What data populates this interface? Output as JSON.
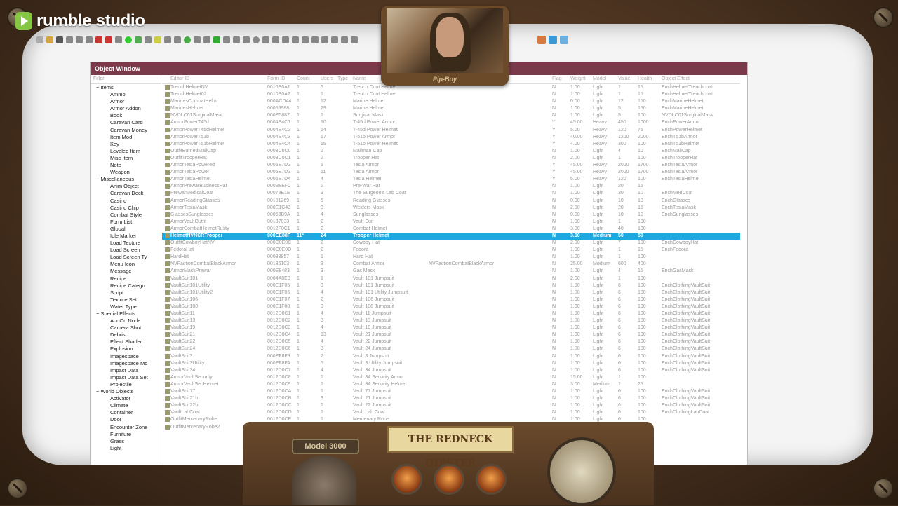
{
  "logo": {
    "brand": "rumble studio"
  },
  "webcam": {
    "label": "Pip-Boy"
  },
  "console": {
    "model_label": "Model 3000",
    "brand_label": "THE REDNECK HIPSTER"
  },
  "object_window": {
    "title": "Object Window",
    "filter_placeholder": "Filter",
    "tree": [
      "Items",
      "Ammo",
      "Armor",
      "Armor Addon",
      "Book",
      "Caravan Card",
      "Caravan Money",
      "Item Mod",
      "Key",
      "Leveled Item",
      "Misc Item",
      "Note",
      "Weapon",
      "Miscellaneous",
      "Anim Object",
      "Caravan Deck",
      "Casino",
      "Casino Chip",
      "Combat Style",
      "Form List",
      "Global",
      "Idle Marker",
      "Load Texture",
      "Load Screen",
      "Load Screen Ty",
      "Menu Icon",
      "Message",
      "Recipe",
      "Recipe Catego",
      "Script",
      "Texture Set",
      "Water Type",
      "Special Effects",
      "AddOn Node",
      "Camera Shot",
      "Debris",
      "Effect Shader",
      "Explosion",
      "Imagespace",
      "Imagespace Mo",
      "Impact Data",
      "Impact Data Set",
      "Projectile",
      "World Objects",
      "Activator",
      "Climate",
      "Container",
      "Door",
      "Encounter Zone",
      "Furniture",
      "Grass",
      "Light"
    ],
    "columns": [
      "Editor ID",
      "Form ID",
      "Count",
      "Users",
      "Type",
      "Name",
      "",
      "Flag",
      "Weight",
      "Model",
      "Value",
      "Health",
      "Object Effect"
    ],
    "rows": [
      [
        "TrenchHelmetNV",
        "0010E0A1",
        "1",
        "5",
        "",
        "Trench Coat Helmet",
        "",
        "N",
        "1.00",
        "Light",
        "1",
        "15",
        "EnchHelmetTrenchcoat"
      ],
      [
        "TrenchHelmet02",
        "0010E0A2",
        "1",
        "1",
        "",
        "Trench Coat Helmet",
        "",
        "N",
        "1.00",
        "Light",
        "1",
        "15",
        "EnchHelmetTrenchcoat"
      ],
      [
        "MarinesCombatHelm",
        "000ACD44",
        "1",
        "12",
        "",
        "Marine Helmet",
        "",
        "N",
        "0.00",
        "Light",
        "12",
        "150",
        "EnchMarineHelmet"
      ],
      [
        "MarinesHelmet",
        "00053988",
        "1",
        "29",
        "",
        "Marine Helmet",
        "",
        "N",
        "1.00",
        "Light",
        "5",
        "150",
        "EnchMarineHelmet"
      ],
      [
        "NVDLC01SurgicalMask",
        "000E5887",
        "1",
        "1",
        "",
        "Surgical Mask",
        "",
        "N",
        "1.00",
        "Light",
        "5",
        "100",
        "NVDLC01SurgicalMask"
      ],
      [
        "ArmorPowerT45d",
        "0004E4C1",
        "1",
        "10",
        "",
        "T-45d Power Armor",
        "",
        "Y",
        "45.00",
        "Heavy",
        "450",
        "1000",
        "EnchPowerArmor"
      ],
      [
        "ArmorPowerT45dHelmet",
        "0004E4C2",
        "1",
        "14",
        "",
        "T-45d Power Helmet",
        "",
        "Y",
        "5.00",
        "Heavy",
        "120",
        "75",
        "EnchPowerHelmet"
      ],
      [
        "ArmorPowerT51b",
        "0004E4C3",
        "1",
        "17",
        "",
        "T-51b Power Armor",
        "",
        "Y",
        "40.00",
        "Heavy",
        "1200",
        "2000",
        "EnchT51bArmor"
      ],
      [
        "ArmorPowerT51bHelmet",
        "0004E4C4",
        "1",
        "15",
        "",
        "T-51b Power Helmet",
        "",
        "Y",
        "4.00",
        "Heavy",
        "300",
        "100",
        "EnchT51bHelmet"
      ],
      [
        "OutfitBurnedMailCap",
        "0003C0C0",
        "1",
        "2",
        "",
        "Mailman Cap",
        "",
        "N",
        "1.00",
        "Light",
        "4",
        "10",
        "EnchMailCap"
      ],
      [
        "OutfitTrooperHat",
        "0003C0C1",
        "1",
        "2",
        "",
        "Trooper Hat",
        "",
        "N",
        "2.00",
        "Light",
        "1",
        "100",
        "EnchTrooperHat"
      ],
      [
        "ArmorTeslaPowered",
        "0006E7D2",
        "1",
        "5",
        "",
        "Tesla Armor",
        "",
        "Y",
        "45.00",
        "Heavy",
        "2000",
        "1700",
        "EnchTeslaArmor"
      ],
      [
        "ArmorTeslaPower",
        "0006E7D3",
        "1",
        "11",
        "",
        "Tesla Armor",
        "",
        "Y",
        "45.00",
        "Heavy",
        "2000",
        "1700",
        "EnchTeslaArmor"
      ],
      [
        "ArmorTeslaHelmet",
        "0006E7D4",
        "1",
        "4",
        "",
        "Tesla Helmet",
        "",
        "Y",
        "5.00",
        "Heavy",
        "120",
        "100",
        "EnchTeslaHelmet"
      ],
      [
        "ArmorPrewarBusinessHat",
        "000B8EF0",
        "1",
        "2",
        "",
        "Pre-War Hat",
        "",
        "N",
        "1.00",
        "Light",
        "20",
        "15",
        ""
      ],
      [
        "PrewarMedicalCoat",
        "00078E1E",
        "1",
        "3",
        "",
        "The Surgeon's Lab Coat",
        "",
        "N",
        "1.00",
        "Light",
        "30",
        "10",
        "EnchMedCoat"
      ],
      [
        "ArmorReadingGlasses",
        "00101269",
        "1",
        "5",
        "",
        "Reading Glasses",
        "",
        "N",
        "0.00",
        "Light",
        "10",
        "10",
        "EnchGlasses"
      ],
      [
        "ArmorTeslaMask",
        "000E1C43",
        "1",
        "3",
        "",
        "Welders Mask",
        "",
        "N",
        "2.00",
        "Light",
        "20",
        "15",
        "EnchTeslaMask"
      ],
      [
        "GlassesSunglasses",
        "00053B9A",
        "1",
        "4",
        "",
        "Sunglasses",
        "",
        "N",
        "0.00",
        "Light",
        "10",
        "10",
        "EnchSunglasses"
      ],
      [
        "ArmorVaultOutfit",
        "00137033",
        "1",
        "2",
        "",
        "Vault Suit",
        "",
        "N",
        "1.00",
        "Light",
        "1",
        "100",
        ""
      ],
      [
        "ArmorCombatHelmetRusty",
        "0012F0C1",
        "1",
        "2",
        "",
        "Combat Helmet",
        "",
        "N",
        "3.00",
        "Light",
        "40",
        "100",
        ""
      ],
      [
        "HelmetNVNCRTrooper",
        "000EE88F",
        "11*",
        "24",
        "",
        "Trooper Helmet",
        "",
        "N",
        "3.00",
        "Medium",
        "50",
        "50",
        ""
      ],
      [
        "OutfitCowboyHatNV",
        "000C0E0C",
        "1",
        "2",
        "",
        "Cowboy Hat",
        "",
        "N",
        "2.00",
        "Light",
        "7",
        "100",
        "EnchCowboyHat"
      ],
      [
        "FedoraHat",
        "000C0E0D",
        "1",
        "2",
        "",
        "Fedora",
        "",
        "N",
        "1.00",
        "Light",
        "1",
        "15",
        "EnchFedora"
      ],
      [
        "HardHat",
        "00088857",
        "1",
        "1",
        "",
        "Hard Hat",
        "",
        "N",
        "1.00",
        "Light",
        "1",
        "100",
        ""
      ],
      [
        "NVFactionCombatBlackArmor",
        "00136103",
        "1",
        "3",
        "",
        "Combat Armor",
        "NVFactionCombatBlackArmor",
        "N",
        "25.00",
        "Medium",
        "600",
        "400",
        ""
      ],
      [
        "ArmorMaskPrewar",
        "000E8483",
        "1",
        "3",
        "",
        "Gas Mask",
        "",
        "N",
        "1.00",
        "Light",
        "4",
        "15",
        "EnchGasMask"
      ],
      [
        "VaultSuit101",
        "0004A8E0",
        "1",
        "1",
        "",
        "Vault 101 Jumpsuit",
        "",
        "N",
        "2.00",
        "Light",
        "1",
        "100",
        ""
      ],
      [
        "VaultSuit101Utility",
        "000E1F05",
        "1",
        "3",
        "",
        "Vault 101 Jumpsuit",
        "",
        "N",
        "1.00",
        "Light",
        "6",
        "100",
        "EnchClothingVaultSuit"
      ],
      [
        "VaultSuit101Utility2",
        "000E1F06",
        "1",
        "4",
        "",
        "Vault 101 Utility Jumpsuit",
        "",
        "N",
        "1.00",
        "Light",
        "6",
        "100",
        "EnchClothingVaultSuit"
      ],
      [
        "VaultSuit106",
        "000E1F07",
        "1",
        "2",
        "",
        "Vault 106 Jumpsuit",
        "",
        "N",
        "1.00",
        "Light",
        "6",
        "100",
        "EnchClothingVaultSuit"
      ],
      [
        "VaultSuit108",
        "000E1F08",
        "1",
        "3",
        "",
        "Vault 108 Jumpsuit",
        "",
        "N",
        "1.00",
        "Light",
        "6",
        "100",
        "EnchClothingVaultSuit"
      ],
      [
        "VaultSuit11",
        "0012D0C1",
        "1",
        "4",
        "",
        "Vault 11 Jumpsuit",
        "",
        "N",
        "1.00",
        "Light",
        "6",
        "100",
        "EnchClothingVaultSuit"
      ],
      [
        "VaultSuit13",
        "0012D0C2",
        "1",
        "3",
        "",
        "Vault 13 Jumpsuit",
        "",
        "N",
        "1.00",
        "Light",
        "6",
        "100",
        "EnchClothingVaultSuit"
      ],
      [
        "VaultSuit19",
        "0012D0C3",
        "1",
        "4",
        "",
        "Vault 19 Jumpsuit",
        "",
        "N",
        "1.00",
        "Light",
        "6",
        "100",
        "EnchClothingVaultSuit"
      ],
      [
        "VaultSuit21",
        "0012D0C4",
        "1",
        "13",
        "",
        "Vault 21 Jumpsuit",
        "",
        "N",
        "1.00",
        "Light",
        "6",
        "100",
        "EnchClothingVaultSuit"
      ],
      [
        "VaultSuit22",
        "0012D0C5",
        "1",
        "4",
        "",
        "Vault 22 Jumpsuit",
        "",
        "N",
        "1.00",
        "Light",
        "6",
        "100",
        "EnchClothingVaultSuit"
      ],
      [
        "VaultSuit24",
        "0012D0C6",
        "1",
        "3",
        "",
        "Vault 24 Jumpsuit",
        "",
        "N",
        "1.00",
        "Light",
        "6",
        "100",
        "EnchClothingVaultSuit"
      ],
      [
        "VaultSuit3",
        "000EF8F9",
        "1",
        "7",
        "",
        "Vault 3 Jumpsuit",
        "",
        "N",
        "1.00",
        "Light",
        "6",
        "100",
        "EnchClothingVaultSuit"
      ],
      [
        "VaultSuit3Utility",
        "000EF8FA",
        "1",
        "5",
        "",
        "Vault 3 Utility Jumpsuit",
        "",
        "N",
        "1.00",
        "Light",
        "6",
        "100",
        "EnchClothingVaultSuit"
      ],
      [
        "VaultSuit34",
        "0012D0C7",
        "1",
        "4",
        "",
        "Vault 34 Jumpsuit",
        "",
        "N",
        "1.00",
        "Light",
        "6",
        "100",
        "EnchClothingVaultSuit"
      ],
      [
        "ArmorVaultSecurity",
        "0012D0C8",
        "1",
        "1",
        "",
        "Vault 34 Security Armor",
        "",
        "N",
        "15.00",
        "Light",
        "1",
        "100",
        ""
      ],
      [
        "ArmorVaultSecHelmet",
        "0012D0C9",
        "1",
        "1",
        "",
        "Vault 34 Security Helmet",
        "",
        "N",
        "3.00",
        "Medium",
        "1",
        "25",
        ""
      ],
      [
        "VaultSuit77",
        "0012D0CA",
        "1",
        "1",
        "",
        "Vault 77 Jumpsuit",
        "",
        "N",
        "1.00",
        "Light",
        "6",
        "100",
        "EnchClothingVaultSuit"
      ],
      [
        "VaultSuit21b",
        "0012D0CB",
        "1",
        "3",
        "",
        "Vault 21 Jumpsuit",
        "",
        "N",
        "1.00",
        "Light",
        "6",
        "100",
        "EnchClothingVaultSuit"
      ],
      [
        "VaultSuit22b",
        "0012D0CC",
        "1",
        "1",
        "",
        "Vault 22 Jumpsuit",
        "",
        "N",
        "1.00",
        "Light",
        "6",
        "100",
        "EnchClothingVaultSuit"
      ],
      [
        "VaultLabCoat",
        "0012D0CD",
        "1",
        "1",
        "",
        "Vault Lab Coat",
        "",
        "N",
        "1.00",
        "Light",
        "6",
        "100",
        "EnchClothingLabCoat"
      ],
      [
        "OutfitMercenaryRobe",
        "0012D0CE",
        "1",
        "1",
        "",
        "Mercenary Robe",
        "",
        "N",
        "1.00",
        "Light",
        "6",
        "100",
        ""
      ],
      [
        "OutfitMercenaryRobe2",
        "0012D0CF",
        "1",
        "1",
        "",
        "Mercenary Robe",
        "",
        "N",
        "1.00",
        "Light",
        "6",
        "100",
        ""
      ]
    ],
    "selected_row": 21
  }
}
